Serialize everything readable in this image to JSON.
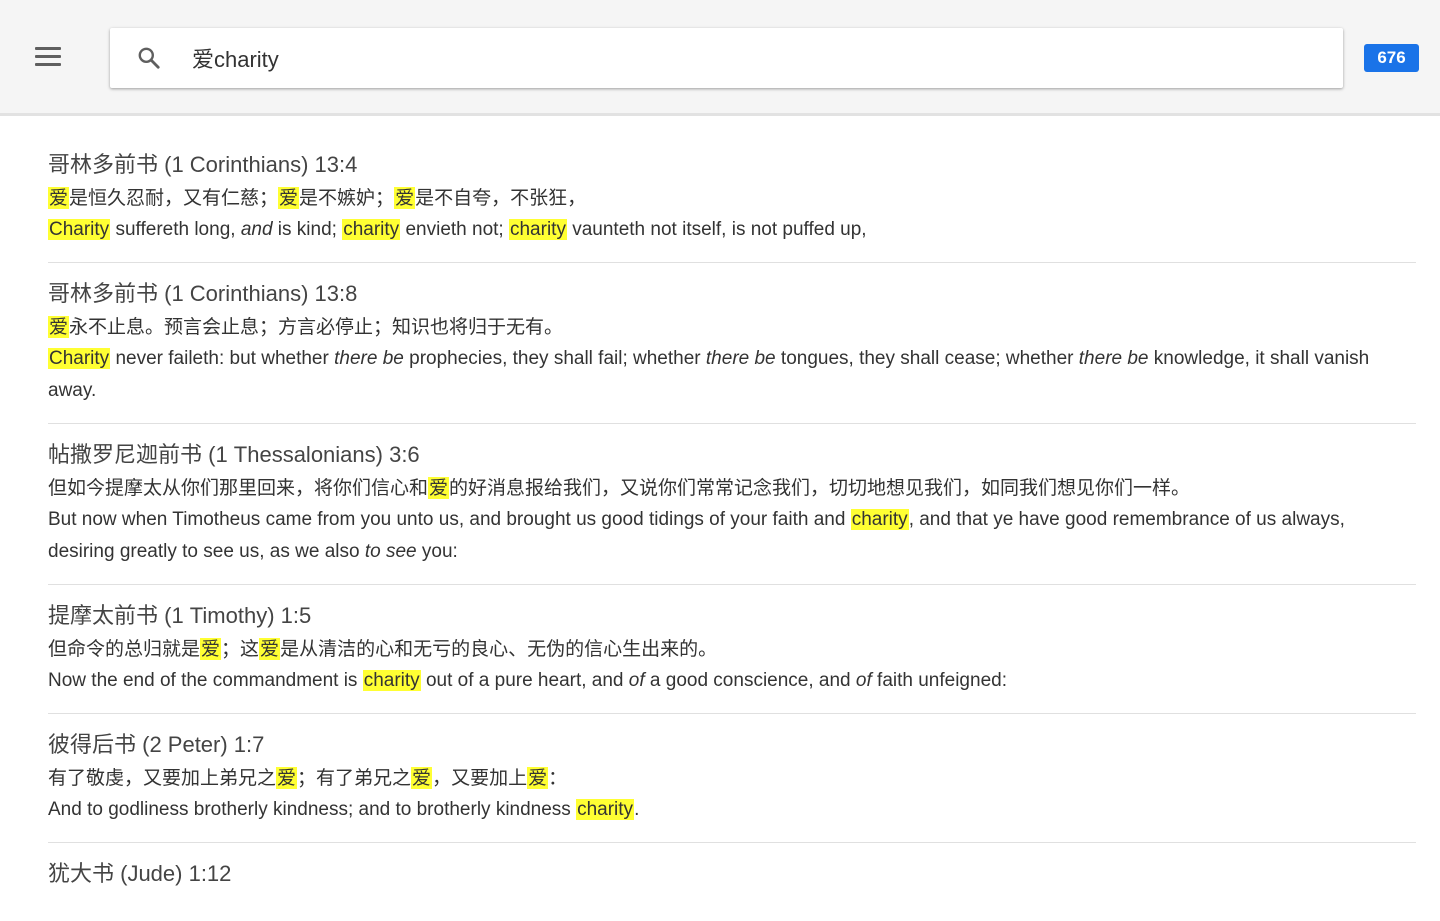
{
  "search": {
    "query": "爱charity",
    "placeholder": "",
    "result_count": "676"
  },
  "results": [
    {
      "reference": "哥林多前书 (1 Corinthians) 13:4",
      "zh": [
        {
          "t": "爱",
          "h": true
        },
        {
          "t": "是恒久忍耐，又有仁慈；"
        },
        {
          "t": "爱",
          "h": true
        },
        {
          "t": "是不嫉妒；"
        },
        {
          "t": "爱",
          "h": true
        },
        {
          "t": "是不自夸，不张狂，"
        }
      ],
      "en": [
        {
          "t": "Charity",
          "h": true
        },
        {
          "t": " suffereth long, "
        },
        {
          "t": "and",
          "i": true
        },
        {
          "t": " is kind; "
        },
        {
          "t": "charity",
          "h": true
        },
        {
          "t": " envieth not; "
        },
        {
          "t": "charity",
          "h": true
        },
        {
          "t": " vaunteth not itself, is not puffed up,"
        }
      ]
    },
    {
      "reference": "哥林多前书 (1 Corinthians) 13:8",
      "zh": [
        {
          "t": "爱",
          "h": true
        },
        {
          "t": "永不止息。预言会止息；方言必停止；知识也将归于无有。"
        }
      ],
      "en": [
        {
          "t": "Charity",
          "h": true
        },
        {
          "t": " never faileth: but whether "
        },
        {
          "t": "there be",
          "i": true
        },
        {
          "t": " prophecies, they shall fail; whether "
        },
        {
          "t": "there be",
          "i": true
        },
        {
          "t": " tongues, they shall cease; whether "
        },
        {
          "t": "there be",
          "i": true
        },
        {
          "t": " knowledge, it shall vanish away."
        }
      ]
    },
    {
      "reference": "帖撒罗尼迦前书 (1 Thessalonians) 3:6",
      "zh": [
        {
          "t": "但如今提摩太从你们那里回来，将你们信心和"
        },
        {
          "t": "爱",
          "h": true
        },
        {
          "t": "的好消息报给我们，又说你们常常记念我们，切切地想见我们，如同我们想见你们一样。"
        }
      ],
      "en": [
        {
          "t": "But now when Timotheus came from you unto us, and brought us good tidings of your faith and "
        },
        {
          "t": "charity",
          "h": true
        },
        {
          "t": ", and that ye have good remembrance of us always, desiring greatly to see us, as we also "
        },
        {
          "t": "to see",
          "i": true
        },
        {
          "t": " you:"
        }
      ]
    },
    {
      "reference": "提摩太前书 (1 Timothy) 1:5",
      "zh": [
        {
          "t": "但命令的总归就是"
        },
        {
          "t": "爱",
          "h": true
        },
        {
          "t": "；这"
        },
        {
          "t": "爱",
          "h": true
        },
        {
          "t": "是从清洁的心和无亏的良心、无伪的信心生出来的。"
        }
      ],
      "en": [
        {
          "t": "Now the end of the commandment is "
        },
        {
          "t": "charity",
          "h": true
        },
        {
          "t": " out of a pure heart, and "
        },
        {
          "t": "of",
          "i": true
        },
        {
          "t": " a good conscience, and "
        },
        {
          "t": "of",
          "i": true
        },
        {
          "t": " faith unfeigned:"
        }
      ]
    },
    {
      "reference": "彼得后书 (2 Peter) 1:7",
      "zh": [
        {
          "t": "有了敬虔，又要加上弟兄之"
        },
        {
          "t": "爱",
          "h": true
        },
        {
          "t": "；有了弟兄之"
        },
        {
          "t": "爱",
          "h": true
        },
        {
          "t": "，又要加上"
        },
        {
          "t": "爱",
          "h": true
        },
        {
          "t": "："
        }
      ],
      "en": [
        {
          "t": "And to godliness brotherly kindness; and to brotherly kindness "
        },
        {
          "t": "charity",
          "h": true
        },
        {
          "t": "."
        }
      ]
    },
    {
      "reference": "犹大书 (Jude) 1:12",
      "zh": [],
      "en": []
    }
  ],
  "colors": {
    "highlight": "#ffff33",
    "badge": "#1a73e8",
    "topbar": "#f5f5f5"
  }
}
